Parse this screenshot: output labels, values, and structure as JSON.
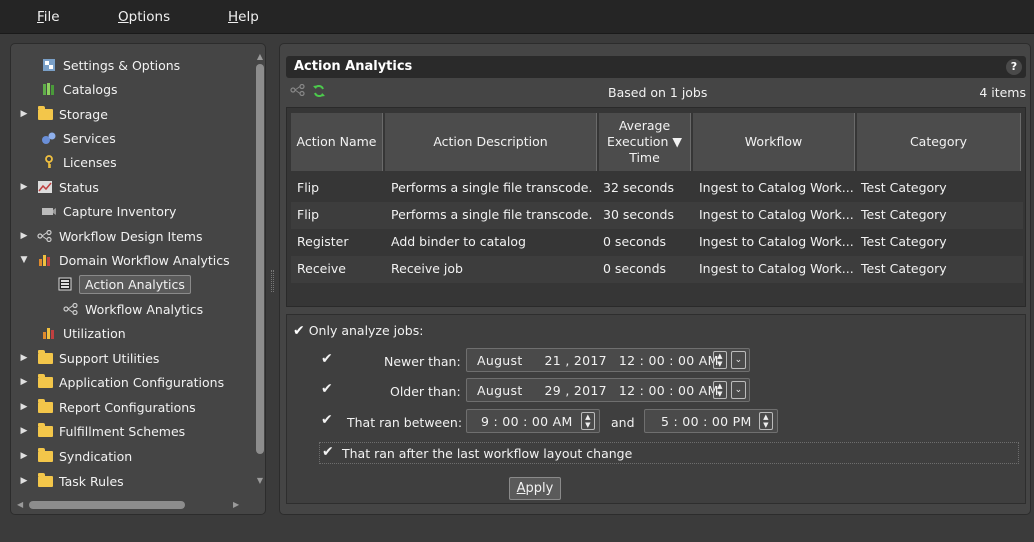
{
  "menu": {
    "file": {
      "u": "F",
      "rest": "ile"
    },
    "options": {
      "u": "O",
      "rest": "ptions"
    },
    "help": {
      "u": "H",
      "rest": "elp"
    }
  },
  "tree": [
    {
      "label": "Settings & Options",
      "icon": "settings-icon",
      "expander": ""
    },
    {
      "label": "Catalogs",
      "icon": "catalogs-icon",
      "expander": ""
    },
    {
      "label": "Storage",
      "icon": "folder-icon",
      "expander": "▶"
    },
    {
      "label": "Services",
      "icon": "services-icon",
      "expander": ""
    },
    {
      "label": "Licenses",
      "icon": "key-icon",
      "expander": ""
    },
    {
      "label": "Status",
      "icon": "status-chart-icon",
      "expander": "▶"
    },
    {
      "label": "Capture Inventory",
      "icon": "capture-icon",
      "expander": ""
    },
    {
      "label": "Workflow Design Items",
      "icon": "workflow-icon",
      "expander": "▶"
    },
    {
      "label": "Domain Workflow Analytics",
      "icon": "analytics-bars-icon",
      "expander": "▼"
    },
    {
      "label": "Action Analytics",
      "icon": "action-analytics-icon",
      "expander": ""
    },
    {
      "label": "Workflow Analytics",
      "icon": "workflow-icon",
      "expander": ""
    },
    {
      "label": "Utilization",
      "icon": "analytics-bars-icon",
      "expander": ""
    },
    {
      "label": "Support Utilities",
      "icon": "folder-icon",
      "expander": "▶"
    },
    {
      "label": "Application Configurations",
      "icon": "folder-icon",
      "expander": "▶"
    },
    {
      "label": "Report Configurations",
      "icon": "folder-icon",
      "expander": "▶"
    },
    {
      "label": "Fulfillment Schemes",
      "icon": "folder-icon",
      "expander": "▶"
    },
    {
      "label": "Syndication",
      "icon": "folder-icon",
      "expander": "▶"
    },
    {
      "label": "Task Rules",
      "icon": "folder-icon",
      "expander": "▶"
    }
  ],
  "panel": {
    "title": "Action Analytics",
    "help": "?",
    "based_on": "Based on 1 jobs",
    "items_count": "4 items"
  },
  "grid": {
    "headers": {
      "action_name": "Action Name",
      "action_description": "Action Description",
      "avg_exec_1": "Average",
      "avg_exec_2": "Execution ▼",
      "avg_exec_3": "Time",
      "workflow": "Workflow",
      "category": "Category"
    },
    "rows": [
      {
        "name": "Flip",
        "desc": "Performs a single file transcode.",
        "time": "32 seconds",
        "workflow": "Ingest to Catalog Work...",
        "category": "Test Category"
      },
      {
        "name": "Flip",
        "desc": "Performs a single file transcode.",
        "time": "30 seconds",
        "workflow": "Ingest to Catalog Work...",
        "category": "Test Category"
      },
      {
        "name": "Register",
        "desc": "Add binder to catalog",
        "time": "0 seconds",
        "workflow": "Ingest to Catalog Work...",
        "category": "Test Category"
      },
      {
        "name": "Receive",
        "desc": "Receive job",
        "time": "0 seconds",
        "workflow": "Ingest to Catalog Work...",
        "category": "Test Category"
      }
    ]
  },
  "filters": {
    "only_analyze": "Only analyze jobs:",
    "newer_than": "Newer than:",
    "newer_month": "August",
    "newer_day": "21 , 2017",
    "newer_time": "12 : 00 : 00  AM",
    "older_than": "Older than:",
    "older_month": "August",
    "older_day": "29 , 2017",
    "older_time": "12 : 00 : 00  AM",
    "ran_between": "That ran between:",
    "between_start": "9 : 00 : 00  AM",
    "and": "and",
    "between_end": "5 : 00 : 00  PM",
    "last_change": "That ran after the last workflow layout change",
    "apply_u": "A",
    "apply_rest": "pply"
  },
  "colors": {
    "folder": "#f3c64a",
    "refresh_green": "#4cc94c",
    "background": "#3b3b3b"
  }
}
